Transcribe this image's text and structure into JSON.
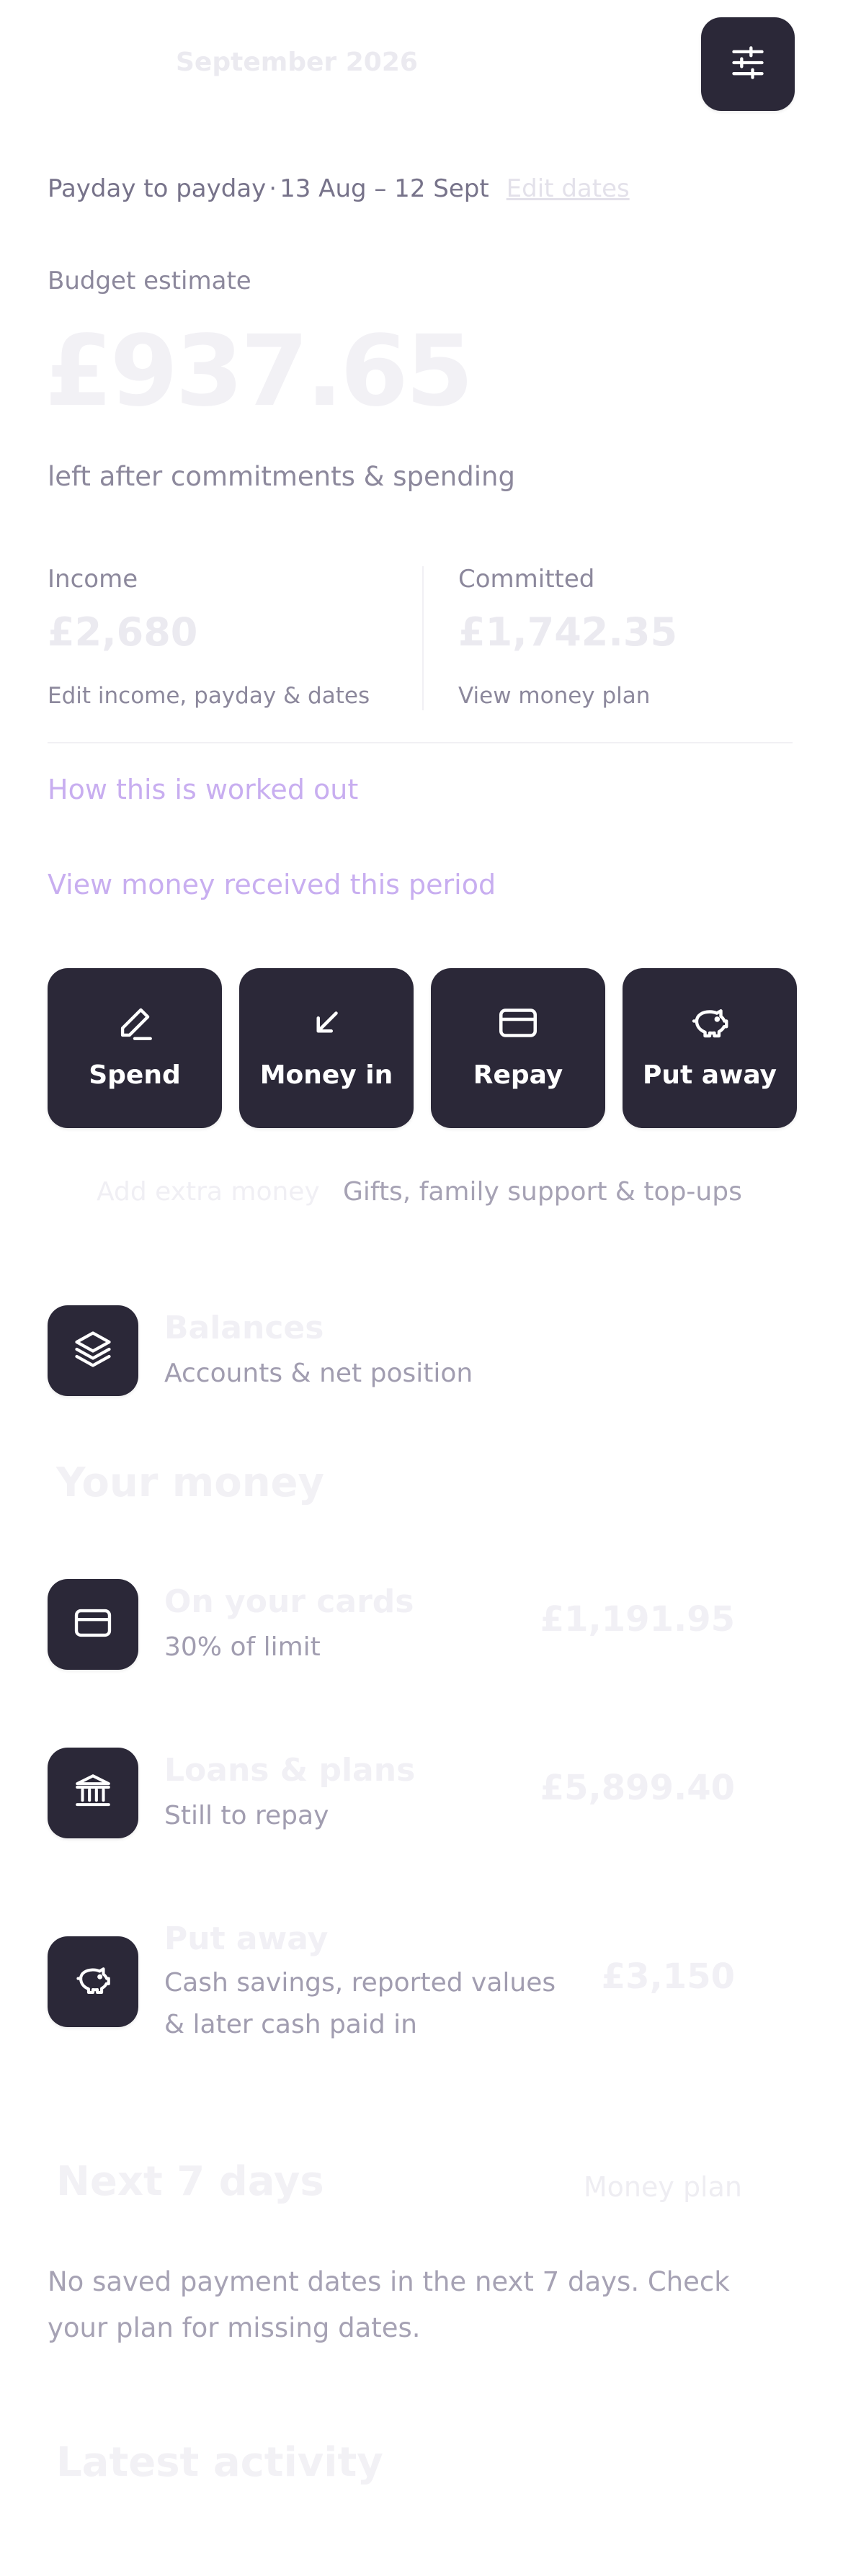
{
  "header": {
    "month": "September 2026",
    "filter_icon": "sliders-icon"
  },
  "period": {
    "label": "Payday to payday",
    "separator": "·",
    "range": "13 Aug – 12 Sept",
    "edit_link": "Edit dates"
  },
  "budget": {
    "label": "Budget estimate",
    "amount": "£937.65",
    "subtitle": "left after commitments & spending"
  },
  "income": {
    "label": "Income",
    "amount": "£2,680",
    "link": "Edit income, payday & dates"
  },
  "committed": {
    "label": "Committed",
    "amount": "£1,742.35",
    "link": "View money plan"
  },
  "links": {
    "how_worked_out": "How this is worked out",
    "money_received": "View money received this period"
  },
  "actions": [
    {
      "label": "Spend",
      "icon": "pen-icon"
    },
    {
      "label": "Money in",
      "icon": "arrow-down-left-icon"
    },
    {
      "label": "Repay",
      "icon": "card-icon"
    },
    {
      "label": "Put away",
      "icon": "piggy-bank-icon"
    }
  ],
  "extra_money": {
    "title": "Add extra money",
    "subtitle": "Gifts, family support & top-ups"
  },
  "balances": {
    "title": "Balances",
    "subtitle": "Accounts & net position",
    "icon": "layers-icon"
  },
  "your_money": {
    "heading": "Your money",
    "rows": [
      {
        "title": "On your cards",
        "subtitle": "30% of limit",
        "amount": "£1,191.95",
        "icon": "card-icon"
      },
      {
        "title": "Loans & plans",
        "subtitle": "Still to repay",
        "amount": "£5,899.40",
        "icon": "bank-icon"
      },
      {
        "title": "Put away",
        "subtitle": "Cash savings, reported values & later cash paid in",
        "amount": "£3,150",
        "icon": "piggy-bank-icon"
      }
    ]
  },
  "next7": {
    "heading": "Next 7 days",
    "link": "Money plan",
    "empty_text": "No saved payment dates in the next 7 days. Check your plan for missing dates."
  },
  "latest": {
    "heading": "Latest activity"
  },
  "colors": {
    "dark_tile": "#2b2838",
    "accent_link": "#c8aef0",
    "muted_text": "#8c889c"
  }
}
